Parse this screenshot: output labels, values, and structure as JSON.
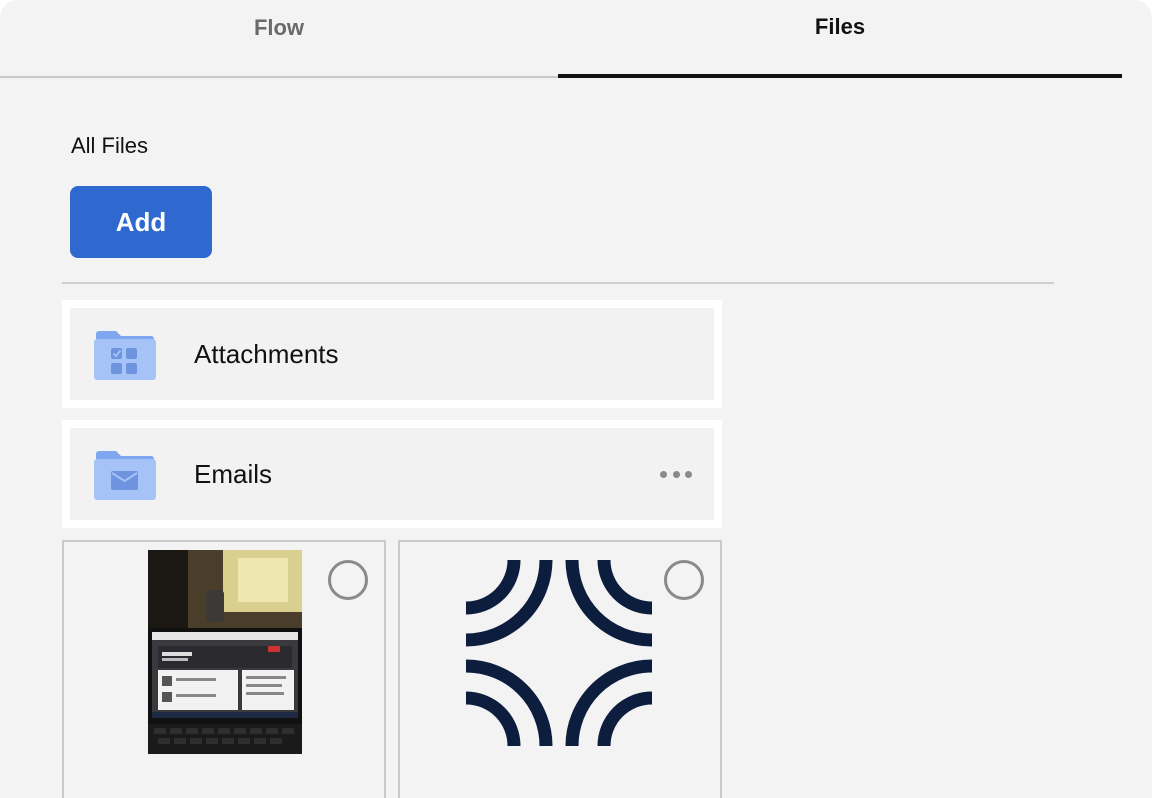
{
  "tabs": [
    {
      "label": "Flow",
      "active": false
    },
    {
      "label": "Files",
      "active": true
    }
  ],
  "section": {
    "title": "All Files"
  },
  "actions": {
    "add_label": "Add"
  },
  "folders": [
    {
      "name": "Attachments",
      "icon": "folder-grid-icon"
    },
    {
      "name": "Emails",
      "icon": "folder-mail-icon",
      "has_menu": true
    }
  ],
  "files": [
    {
      "kind": "photo",
      "thumbnail": "laptop-photo",
      "selected": false
    },
    {
      "kind": "image",
      "thumbnail": "arc-logo",
      "selected": false
    }
  ],
  "colors": {
    "accent": "#2f69d0",
    "folder": "#7fa7f0",
    "folder_light": "#a6c3f7",
    "logo": "#0c1d3d",
    "panel_bg": "#f3f3f3"
  }
}
